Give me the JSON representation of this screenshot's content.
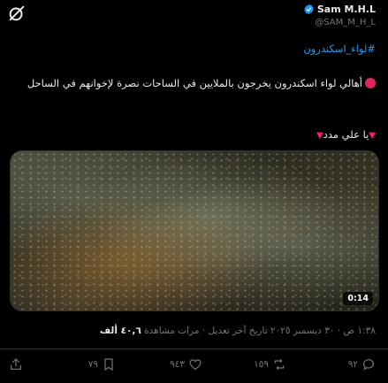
{
  "author": {
    "name": "Sam M.H.L",
    "handle": "@SAM_M_H_L"
  },
  "tweet": {
    "hashtag": "#لواء_اسكندرون",
    "body": "أهالي لواء اسكندرون يخرجون بالملايين في الساحات نصرة لإخوانهم في الساحل",
    "line2": "يا علي مدد",
    "timestamp": "١:٣٨ ص · ٣٠ ديسمبر ٢٠٢٥ تاريخ آخر تعديل ·",
    "views_value": "٤٠,٦ ألف",
    "views_label": "مرات مشاهدة"
  },
  "video": {
    "duration": "0:14"
  },
  "actions": {
    "replies": "٩٢",
    "retweets": "١٥٩",
    "likes": "٩٤٣",
    "bookmarks": "٧٩"
  },
  "colors": {
    "accent": "#1d9bf0",
    "verified": "#1d9bf0",
    "red_dot": "#e0245e",
    "heart_triangle": "#f91880",
    "muted": "#71767b"
  },
  "icons": [
    "grok-icon",
    "verified-badge-icon",
    "reply-icon",
    "retweet-icon",
    "like-icon",
    "bookmark-icon",
    "share-icon"
  ]
}
